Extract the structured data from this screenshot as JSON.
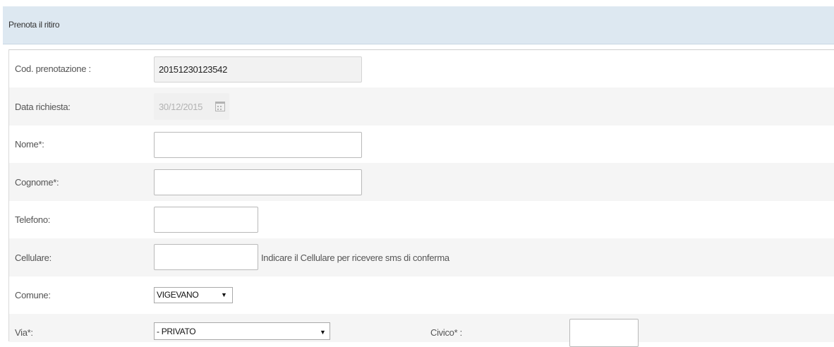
{
  "panel": {
    "title": "Prenota il ritiro"
  },
  "form": {
    "cod_prenotazione": {
      "label": "Cod. prenotazione :",
      "value": "20151230123542"
    },
    "data_richiesta": {
      "label": "Data richiesta:",
      "value": "30/12/2015",
      "icon": "calendar-icon"
    },
    "nome": {
      "label": "Nome*:",
      "value": ""
    },
    "cognome": {
      "label": "Cognome*:",
      "value": ""
    },
    "telefono": {
      "label": "Telefono:",
      "value": ""
    },
    "cellulare": {
      "label": "Cellulare:",
      "value": "",
      "hint": "Indicare il Cellulare per ricevere sms di conferma"
    },
    "comune": {
      "label": "Comune:",
      "selected": "VIGEVANO"
    },
    "via": {
      "label": "Via*:",
      "selected": "- PRIVATO"
    },
    "civico": {
      "label": "Civico* :",
      "value": ""
    }
  }
}
